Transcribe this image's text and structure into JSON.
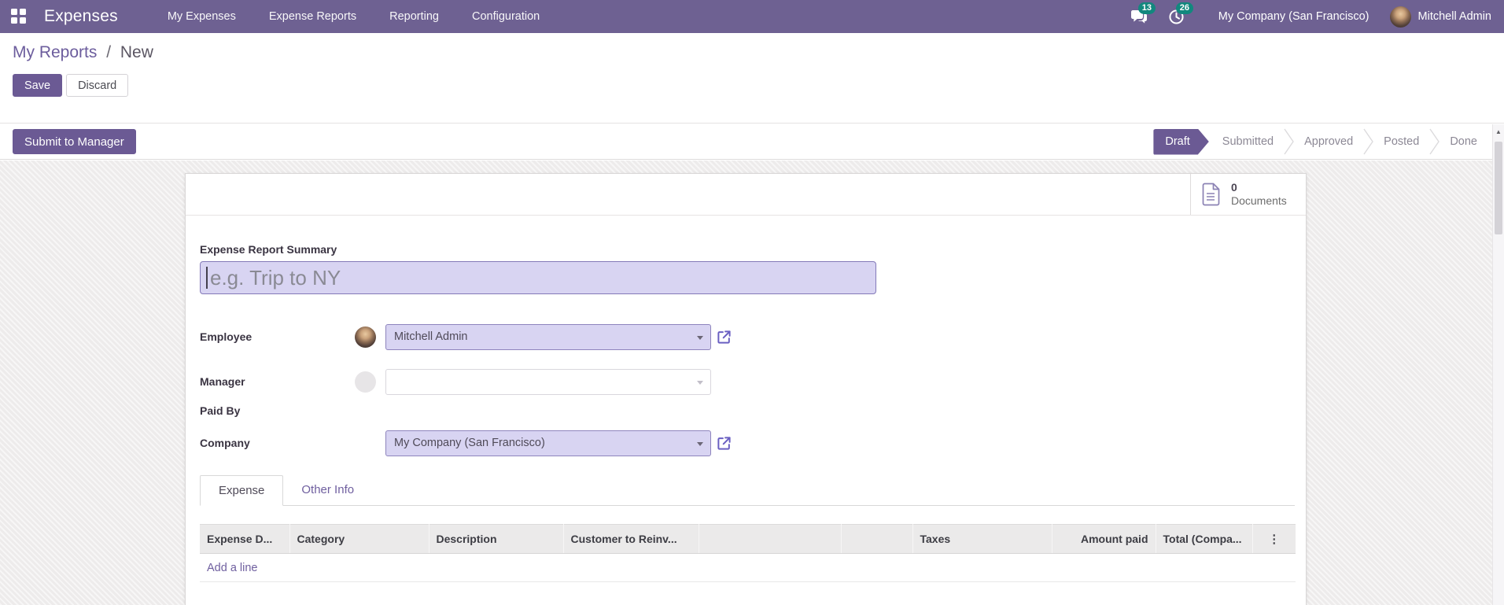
{
  "navbar": {
    "brand": "Expenses",
    "menu_items": [
      "My Expenses",
      "Expense Reports",
      "Reporting",
      "Configuration"
    ],
    "messages_badge": "13",
    "activities_badge": "26",
    "company": "My Company (San Francisco)",
    "user": "Mitchell Admin"
  },
  "breadcrumb": {
    "parent": "My Reports",
    "separator": "/",
    "current": "New"
  },
  "control_panel": {
    "save": "Save",
    "discard": "Discard"
  },
  "status_row": {
    "submit": "Submit to Manager"
  },
  "statusbar": {
    "active_step": "Draft",
    "steps": [
      "Draft",
      "Submitted",
      "Approved",
      "Posted",
      "Done"
    ]
  },
  "sheet": {
    "stat_button": {
      "count": "0",
      "label": "Documents"
    },
    "summary": {
      "label": "Expense Report Summary",
      "placeholder": "e.g. Trip to NY",
      "value": ""
    },
    "fields": {
      "employee": {
        "label": "Employee",
        "value": "Mitchell Admin"
      },
      "manager": {
        "label": "Manager",
        "value": ""
      },
      "paid_by": {
        "label": "Paid By",
        "value": ""
      },
      "company": {
        "label": "Company",
        "value": "My Company (San Francisco)"
      }
    },
    "tabs": [
      "Expense",
      "Other Info"
    ],
    "active_tab": "Expense",
    "table": {
      "headers": [
        "Expense D...",
        "Category",
        "Description",
        "Customer to Reinv...",
        "",
        "",
        "Taxes",
        "Amount paid",
        "Total (Compa..."
      ],
      "add_line_label": "Add a line"
    }
  },
  "icons": {
    "column_options": "⋮",
    "scroll_up": "▲"
  },
  "colors": {
    "navbar_bg": "#6e6192",
    "primary_button": "#6b5a94",
    "badge": "#12887e",
    "field_highlight_bg": "#d8d4f2",
    "link": "#6f5f9f",
    "status_active_bg": "#6b5a94"
  }
}
